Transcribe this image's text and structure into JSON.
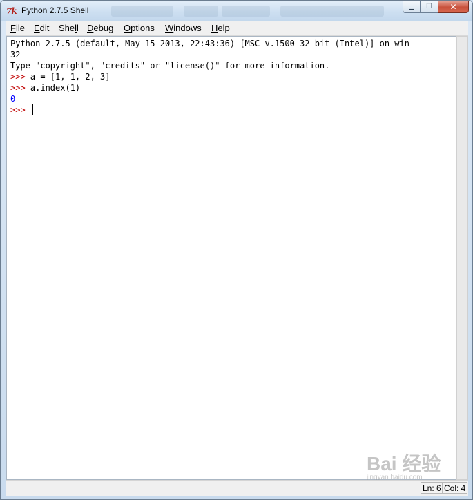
{
  "window": {
    "title": "Python 2.7.5 Shell",
    "icon_text": "7k",
    "buttons": {
      "minimize": "▁",
      "maximize": "☐",
      "close": "✕"
    }
  },
  "menu": [
    {
      "label": "File",
      "mnemonic": "F",
      "rest": "ile"
    },
    {
      "label": "Edit",
      "mnemonic": "E",
      "rest": "dit"
    },
    {
      "label": "Shell",
      "pre": "She",
      "mnemonic": "l",
      "rest": "l"
    },
    {
      "label": "Debug",
      "mnemonic": "D",
      "rest": "ebug"
    },
    {
      "label": "Options",
      "mnemonic": "O",
      "rest": "ptions"
    },
    {
      "label": "Windows",
      "mnemonic": "W",
      "rest": "indows"
    },
    {
      "label": "Help",
      "mnemonic": "H",
      "rest": "elp"
    }
  ],
  "shell": {
    "banner1": "Python 2.7.5 (default, May 15 2013, 22:43:36) [MSC v.1500 32 bit (Intel)] on win",
    "banner2": "32",
    "banner3": "Type \"copyright\", \"credits\" or \"license()\" for more information.",
    "prompt": ">>> ",
    "cmd1": "a = [1, 1, 2, 3]",
    "cmd2": "a.index(1)",
    "result": "0",
    "prompt_last": ">>> "
  },
  "status": {
    "line": "Ln: 6",
    "col": "Col: 4"
  },
  "watermark": {
    "main": "Bai 经验",
    "sub": "jingyan.baidu.com"
  },
  "colors": {
    "prompt": "#c00000",
    "result": "#0000ff"
  }
}
